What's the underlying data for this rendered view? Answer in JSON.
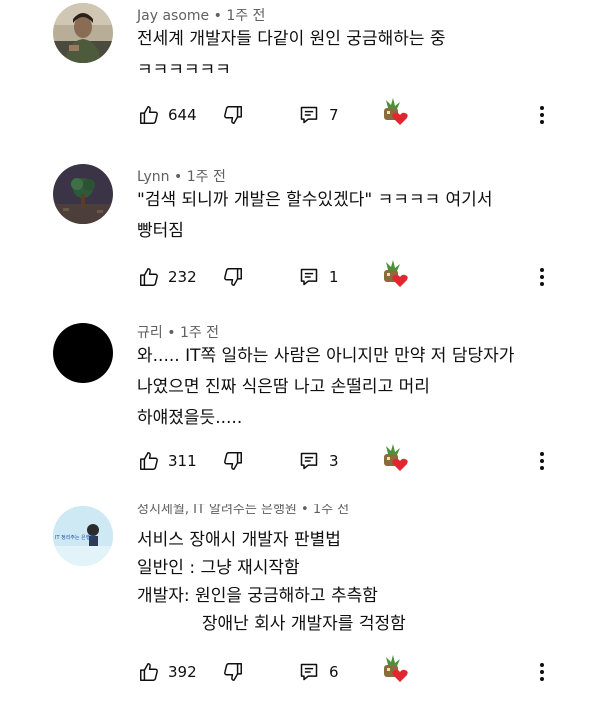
{
  "comments": [
    {
      "author": "Jay asome",
      "time": "1주 전",
      "lines": [
        "전세계 개발자들 다같이 원인 궁금해하는 중",
        "ㅋㅋㅋㅋㅋㅋ"
      ],
      "likes": "644",
      "replies": "7"
    },
    {
      "author": "Lynn",
      "time": "1주 전",
      "lines": [
        "\"검색 되니까 개발은 할수있겠다\" ㅋㅋㅋㅋ 여기서",
        "빵터짐"
      ],
      "likes": "232",
      "replies": "1"
    },
    {
      "author": "규리",
      "time": "1주 전",
      "lines": [
        "와..... IT쪽 일하는 사람은 아니지만 만약 저 담당자가",
        "나였으면 진짜 식은땀 나고 손떨리고 머리",
        "하얘졌을듯....."
      ],
      "likes": "311",
      "replies": "3"
    },
    {
      "author": "정지세월, IT 알려주는 은행원",
      "time": "1주 전",
      "avatar_text": "IT 정리주는 은행원",
      "lines": [
        "서비스 장애시 개발자 판별법",
        "일반인 : 그냥 재시작함",
        "개발자: 원인을 궁금해하고 추측함",
        "            장애난 회사 개발자를 걱정함"
      ],
      "likes": "392",
      "replies": "6"
    }
  ],
  "icons": {
    "like": "thumbs-up-icon",
    "dislike": "thumbs-down-icon",
    "reply": "reply-icon",
    "creator_heart": "creator-heart-icon",
    "more": "more-vert-icon"
  },
  "colors": {
    "heart": "#e0262e",
    "meta": "#606060"
  }
}
